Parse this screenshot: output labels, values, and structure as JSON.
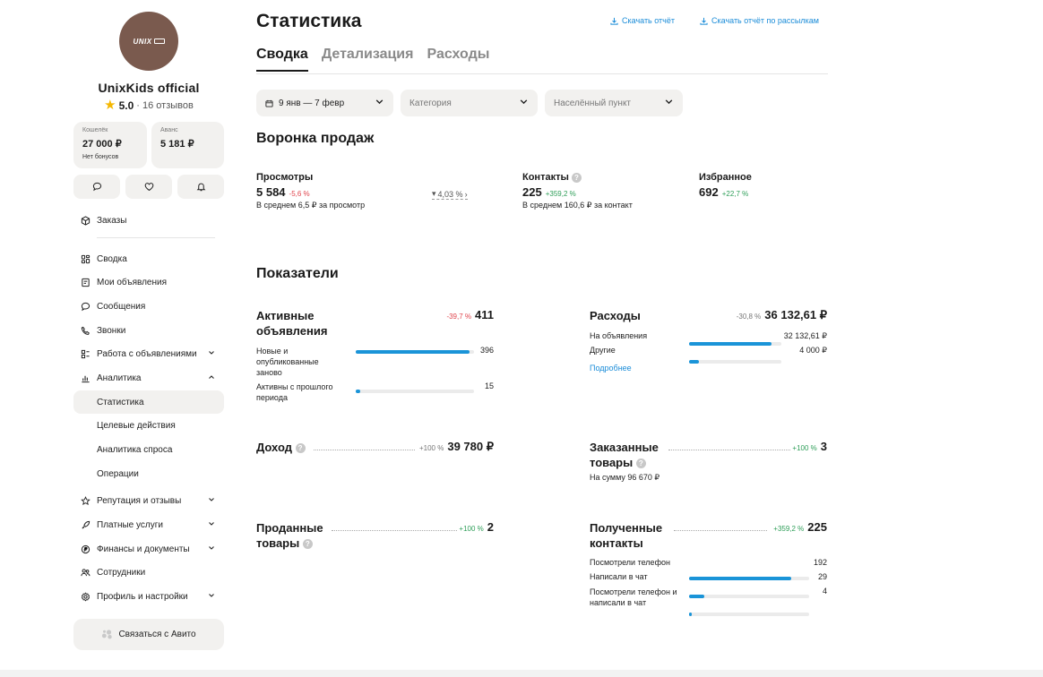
{
  "seller": {
    "logo_text": "UNIX",
    "name": "UnixKids official",
    "rating": "5.0",
    "reviews": "· 16 отзывов"
  },
  "wallet": {
    "label": "Кошелёк",
    "amount": "27 000 ₽",
    "sub": "Нет бонусов"
  },
  "advance": {
    "label": "Аванс",
    "amount": "5 181 ₽"
  },
  "sidebar": {
    "orders": "Заказы",
    "items": [
      {
        "label": "Сводка",
        "icon": "grid-icon"
      },
      {
        "label": "Мои объявления",
        "icon": "ads-icon"
      },
      {
        "label": "Сообщения",
        "icon": "chat-icon"
      },
      {
        "label": "Звонки",
        "icon": "phone-icon"
      },
      {
        "label": "Работа с объявлениями",
        "icon": "list-icon"
      },
      {
        "label": "Аналитика",
        "icon": "chart-icon"
      }
    ],
    "analytics_sub": [
      "Статистика",
      "Целевые действия",
      "Аналитика спроса",
      "Операции"
    ],
    "items2": [
      {
        "label": "Репутация и отзывы",
        "icon": "star-outline-icon"
      },
      {
        "label": "Платные услуги",
        "icon": "rocket-icon"
      },
      {
        "label": "Финансы и документы",
        "icon": "finance-icon"
      },
      {
        "label": "Сотрудники",
        "icon": "users-icon"
      },
      {
        "label": "Профиль и настройки",
        "icon": "settings-icon"
      }
    ],
    "contact": "Связаться с Авито"
  },
  "header": {
    "title": "Статистика",
    "download1": "Скачать отчёт",
    "download2": "Скачать отчёт по рассылкам",
    "tabs": [
      "Сводка",
      "Детализация",
      "Расходы"
    ]
  },
  "filters": {
    "date": "9 янв — 7 февр",
    "category": "Категория",
    "city": "Населённый пункт"
  },
  "funnel": {
    "title": "Воронка продаж",
    "views": {
      "label": "Просмотры",
      "value": "5 584",
      "delta": "-5,6 %",
      "sub": "В среднем 6,5 ₽ за просмотр"
    },
    "conversion": "4,03 %",
    "contacts": {
      "label": "Контакты",
      "value": "225",
      "delta": "+359,2 %",
      "sub": "В среднем 160,6 ₽ за контакт"
    },
    "favorites": {
      "label": "Избранное",
      "value": "692",
      "delta": "+22,7 %"
    }
  },
  "indicators": {
    "title": "Показатели",
    "active": {
      "title": "Активные объявления",
      "delta": "-39,7 %",
      "total": "411",
      "rows": [
        {
          "label": "Новые и опубликованные заново",
          "value": "396",
          "share": 0.96
        },
        {
          "label": "Активны с прошлого периода",
          "value": "15",
          "share": 0.04
        }
      ]
    },
    "expenses": {
      "title": "Расходы",
      "delta": "-30,8 %",
      "total": "36 132,61 ₽",
      "rows": [
        {
          "label": "На объявления",
          "value": "32 132,61 ₽",
          "share": 0.89
        },
        {
          "label": "Другие",
          "value": "4 000 ₽",
          "share": 0.11
        }
      ],
      "more": "Подробнее"
    },
    "income": {
      "title": "Доход",
      "delta": "+100 %",
      "total": "39 780 ₽"
    },
    "ordered": {
      "title": "Заказанные товары",
      "delta": "+100 %",
      "total": "3",
      "sub": "На сумму 96 670 ₽"
    },
    "sold": {
      "title": "Проданные товары",
      "delta": "+100 %",
      "total": "2"
    },
    "received": {
      "title": "Полученные контакты",
      "delta": "+359,2 %",
      "total": "225",
      "rows": [
        {
          "label": "Посмотрели телефон",
          "value": "192",
          "share": 0.85
        },
        {
          "label": "Написали в чат",
          "value": "29",
          "share": 0.13
        },
        {
          "label": "Посмотрели телефон и написали в чат",
          "value": "4",
          "share": 0.02
        }
      ]
    }
  },
  "colors": {
    "accent": "#1a94d8",
    "negative": "#e0454d",
    "positive": "#2e9e58",
    "card": "#f2f1ef"
  }
}
